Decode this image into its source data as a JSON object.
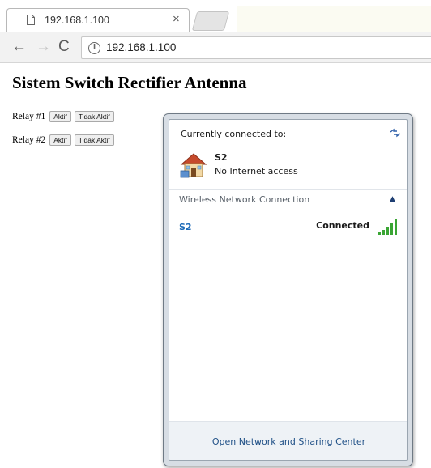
{
  "browser": {
    "tab": {
      "title": "192.168.1.100",
      "close_glyph": "×"
    },
    "toolbar": {
      "back_glyph": "←",
      "forward_glyph": "→",
      "reload_glyph": "C",
      "url": "192.168.1.100",
      "info_glyph": "i"
    }
  },
  "page": {
    "title": "Sistem Switch Rectifier Antenna",
    "relays": [
      {
        "label": "Relay #1",
        "on_label": "Aktif",
        "off_label": "Tidak Aktif"
      },
      {
        "label": "Relay #2",
        "on_label": "Aktif",
        "off_label": "Tidak Aktif"
      }
    ]
  },
  "network_flyout": {
    "header": "Currently connected to:",
    "connection": {
      "name": "S2",
      "status": "No Internet access"
    },
    "section_label": "Wireless Network Connection",
    "collapse_glyph": "▲",
    "networks": [
      {
        "name": "S2",
        "status": "Connected"
      }
    ],
    "footer_link": "Open Network and Sharing Center"
  },
  "icons": {
    "tab_favicon": "page-icon",
    "info": "info-icon",
    "refresh": "refresh-icon",
    "connection": "house-network-icon",
    "signal": "wifi-signal-icon"
  },
  "colors": {
    "link_blue": "#1e6bb8",
    "signal_green": "#3aa534",
    "footer_bg": "#eef2f6"
  }
}
